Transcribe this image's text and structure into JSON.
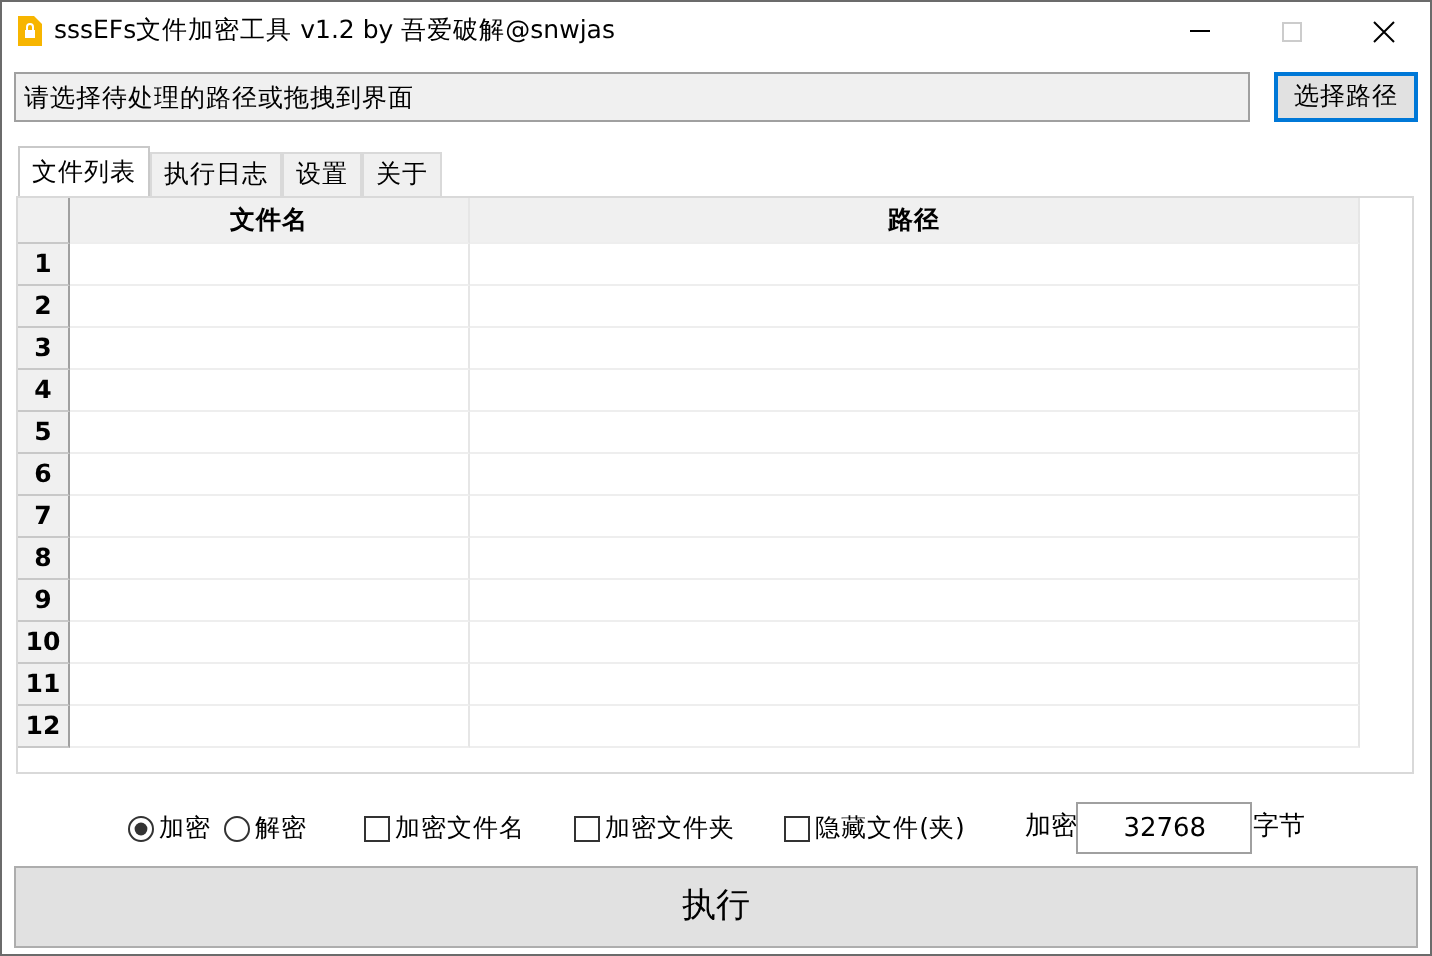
{
  "window": {
    "title": "sssEFs文件加密工具 v1.2 by 吾爱破解@snwjas"
  },
  "path_field": {
    "placeholder": "请选择待处理的路径或拖拽到界面"
  },
  "browse_button": "选择路径",
  "tabs": [
    {
      "label": "文件列表",
      "selected": true
    },
    {
      "label": "执行日志",
      "selected": false
    },
    {
      "label": "设置",
      "selected": false
    },
    {
      "label": "关于",
      "selected": false
    }
  ],
  "table": {
    "columns": [
      "文件名",
      "路径"
    ],
    "rows": [
      "1",
      "2",
      "3",
      "4",
      "5",
      "6",
      "7",
      "8",
      "9",
      "10",
      "11",
      "12"
    ]
  },
  "options": [
    {
      "kind": "radio",
      "label": "加密",
      "checked": true
    },
    {
      "kind": "radio",
      "label": "解密",
      "checked": false
    },
    {
      "kind": "checkbox",
      "label": "加密文件名",
      "checked": false
    },
    {
      "kind": "checkbox",
      "label": "加密文件夹",
      "checked": false
    },
    {
      "kind": "checkbox",
      "label": "隐藏文件(夹)",
      "checked": false
    }
  ],
  "encrypt_size": {
    "label": "加密",
    "value": "32768",
    "unit": "字节"
  },
  "run_button": "执行"
}
